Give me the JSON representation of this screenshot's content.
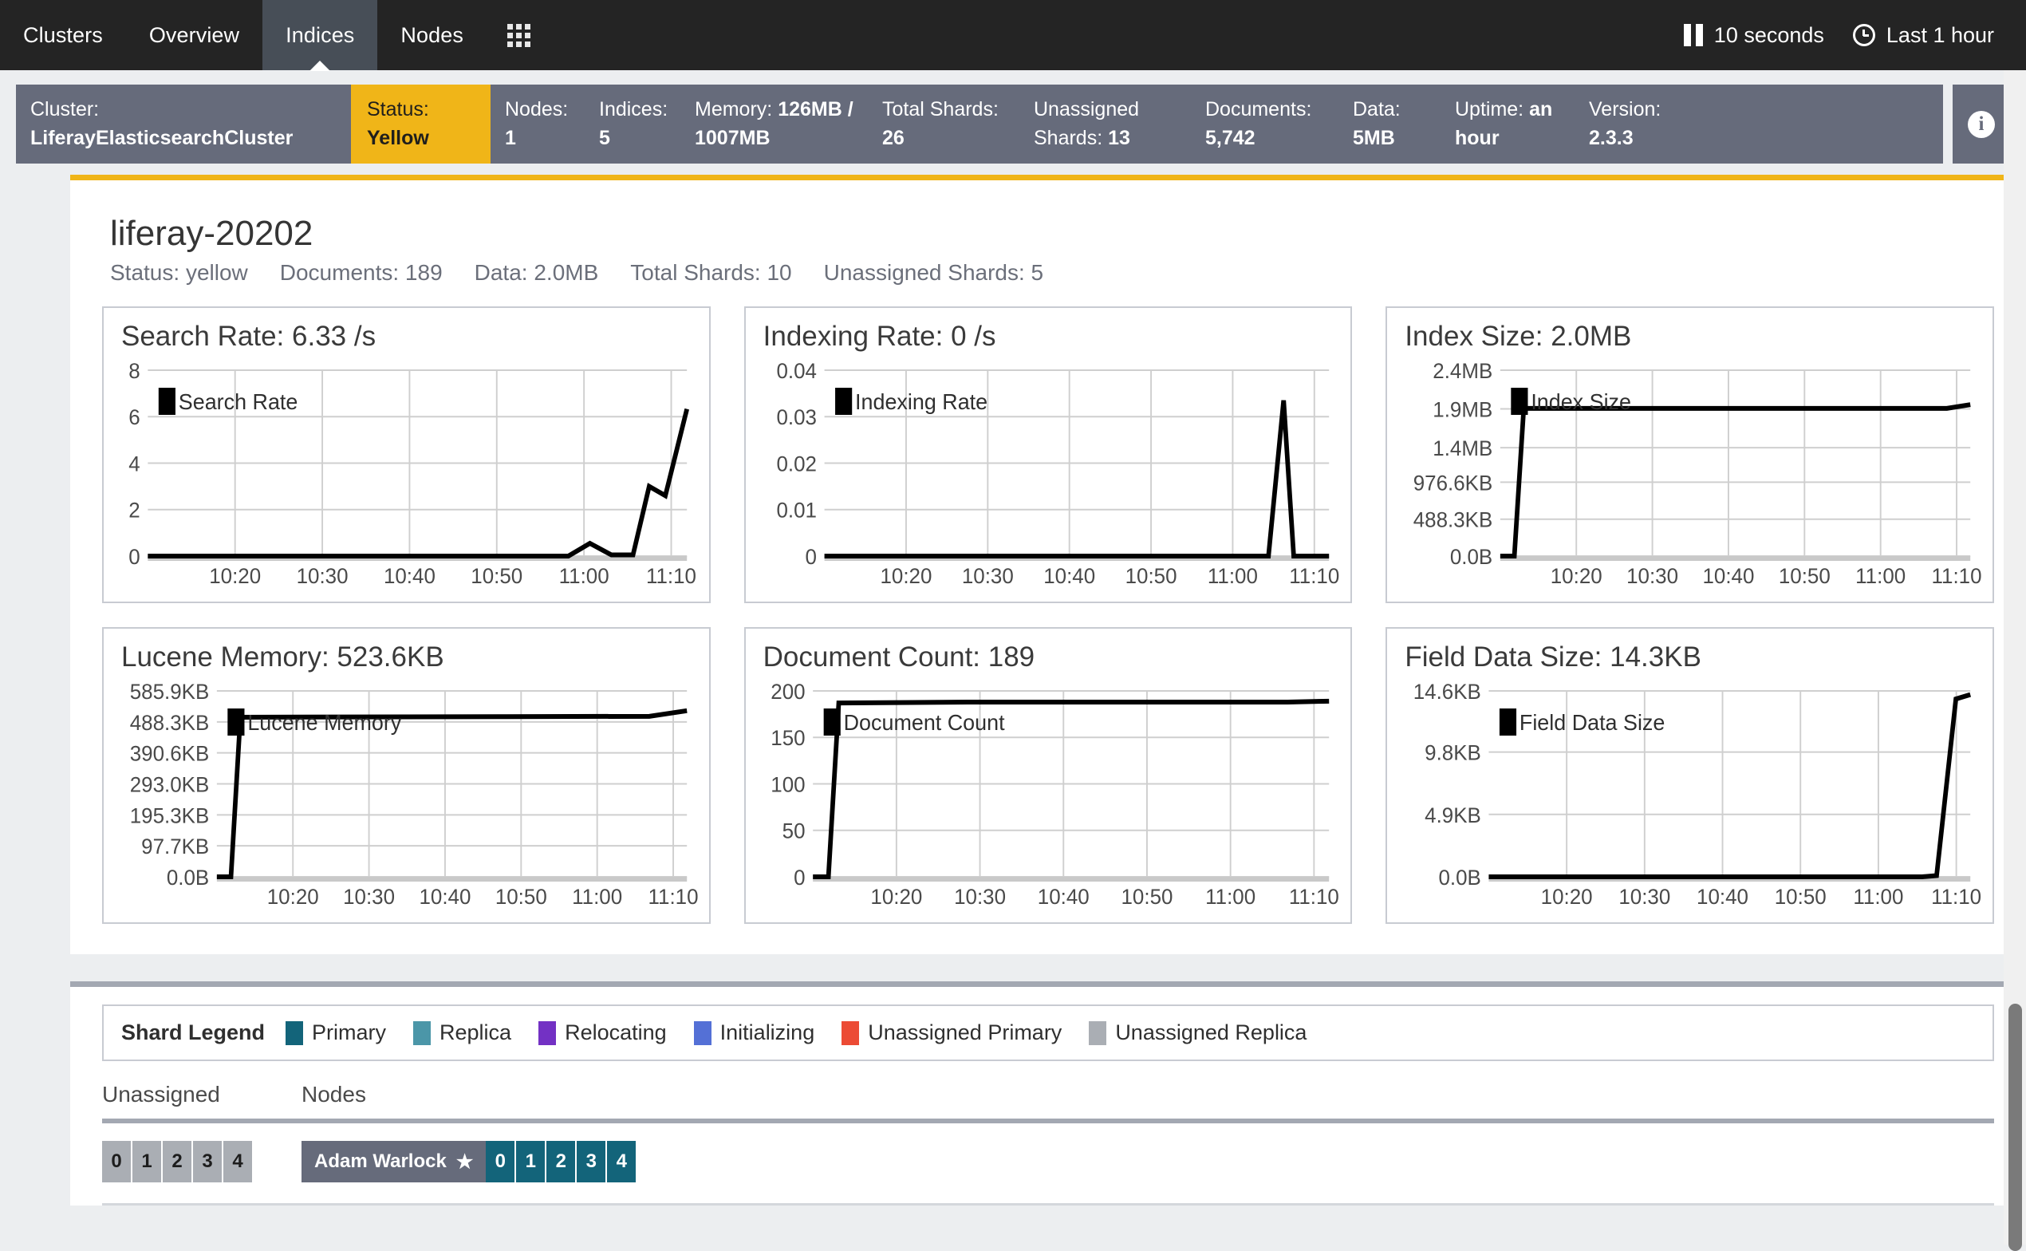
{
  "nav": {
    "items": [
      {
        "label": "Clusters",
        "active": false
      },
      {
        "label": "Overview",
        "active": false
      },
      {
        "label": "Indices",
        "active": true
      },
      {
        "label": "Nodes",
        "active": false
      }
    ],
    "grid_icon": "apps-grid-icon",
    "refresh_interval": "10 seconds",
    "pause_icon": "pause-icon",
    "clock_icon": "clock-icon",
    "time_range": "Last 1 hour"
  },
  "cluster": {
    "name_label": "Cluster:",
    "name_value": "LiferayElasticsearchCluster",
    "status_label": "Status:",
    "status_value": "Yellow",
    "status_color": "#f0b518",
    "info_icon": "info-icon",
    "stats": [
      {
        "label": "Nodes:",
        "value": "1",
        "w": "w-nodes"
      },
      {
        "label": "Indices:",
        "value": "5",
        "w": "w-indices"
      },
      {
        "label": "Memory:",
        "value": "126MB / 1007MB",
        "w": "w-mem"
      },
      {
        "label": "Total Shards:",
        "value": "26",
        "w": "w-total"
      },
      {
        "label": "Unassigned Shards:",
        "value": "13",
        "w": "w-unass"
      },
      {
        "label": "Documents:",
        "value": "5,742",
        "w": "w-docs"
      },
      {
        "label": "Data:",
        "value": "5MB",
        "w": "w-data"
      },
      {
        "label": "Uptime:",
        "value": "an hour",
        "w": "w-uptime"
      },
      {
        "label": "Version:",
        "value": "2.3.3",
        "w": "w-ver"
      }
    ]
  },
  "index": {
    "title": "liferay-20202",
    "stats": [
      "Status: yellow",
      "Documents: 189",
      "Data: 2.0MB",
      "Total Shards: 10",
      "Unassigned Shards: 5"
    ]
  },
  "chart_data": [
    {
      "type": "line",
      "title": "Search Rate: 6.33 /s",
      "legend": "Search Rate",
      "legend_position": "top-left",
      "xlabel": "",
      "ylabel": "",
      "grid": true,
      "ylim": [
        0,
        8
      ],
      "yticks": [
        "0",
        "2",
        "4",
        "6",
        "8"
      ],
      "ytick_values": [
        0,
        2,
        4,
        6,
        8
      ],
      "xticks": [
        "10:20",
        "10:30",
        "10:40",
        "10:50",
        "11:00",
        "11:10"
      ],
      "x": [
        0,
        5,
        12,
        20,
        30,
        40,
        50,
        60,
        68,
        74,
        78,
        82,
        86,
        90,
        93,
        96,
        100
      ],
      "values": [
        0,
        0,
        0,
        0,
        0,
        0,
        0,
        0,
        0,
        0,
        0,
        0.55,
        0.05,
        0.05,
        3.0,
        2.6,
        6.33
      ]
    },
    {
      "type": "line",
      "title": "Indexing Rate: 0 /s",
      "legend": "Indexing Rate",
      "legend_position": "top-left",
      "xlabel": "",
      "ylabel": "",
      "grid": true,
      "ylim": [
        0,
        0.04
      ],
      "yticks": [
        "0",
        "0.01",
        "0.02",
        "0.03",
        "0.04"
      ],
      "ytick_values": [
        0,
        0.01,
        0.02,
        0.03,
        0.04
      ],
      "xticks": [
        "10:20",
        "10:30",
        "10:40",
        "10:50",
        "11:00",
        "11:10"
      ],
      "x": [
        0,
        10,
        20,
        30,
        40,
        50,
        60,
        70,
        80,
        88,
        91,
        93,
        95,
        100
      ],
      "values": [
        0,
        0,
        0,
        0,
        0,
        0,
        0,
        0,
        0,
        0,
        0.0335,
        0.0,
        0,
        0
      ]
    },
    {
      "type": "line",
      "title": "Index Size: 2.0MB",
      "legend": "Index Size",
      "legend_position": "top-left",
      "xlabel": "",
      "ylabel": "",
      "grid": true,
      "ylim": [
        0,
        2516582
      ],
      "yticks": [
        "0.0B",
        "488.3KB",
        "976.6KB",
        "1.4MB",
        "1.9MB",
        "2.4MB"
      ],
      "ytick_values": [
        0,
        500019,
        1000038,
        1468006,
        1992294,
        2516582
      ],
      "xticks": [
        "10:20",
        "10:30",
        "10:40",
        "10:50",
        "11:00",
        "11:10"
      ],
      "x": [
        0,
        3,
        5,
        30,
        60,
        95,
        100
      ],
      "values": [
        0,
        0,
        2000000,
        2000000,
        2000000,
        2000000,
        2050000
      ]
    },
    {
      "type": "line",
      "title": "Lucene Memory: 523.6KB",
      "legend": "Lucene Memory",
      "legend_position": "top-left",
      "xlabel": "",
      "ylabel": "",
      "grid": true,
      "ylim": [
        0,
        599962
      ],
      "yticks": [
        "0.0B",
        "97.7KB",
        "195.3KB",
        "293.0KB",
        "390.6KB",
        "488.3KB",
        "585.9KB"
      ],
      "ytick_values": [
        0,
        100045,
        199987,
        300032,
        399974,
        500019,
        599962
      ],
      "xticks": [
        "10:20",
        "10:30",
        "10:40",
        "10:50",
        "11:00",
        "11:10"
      ],
      "x": [
        0,
        3,
        5,
        30,
        60,
        92,
        100
      ],
      "values": [
        0,
        0,
        515000,
        516000,
        517000,
        518000,
        536000
      ]
    },
    {
      "type": "line",
      "title": "Document Count: 189",
      "legend": "Document Count",
      "legend_position": "top-left",
      "xlabel": "",
      "ylabel": "",
      "grid": true,
      "ylim": [
        0,
        200
      ],
      "yticks": [
        "0",
        "50",
        "100",
        "150",
        "200"
      ],
      "ytick_values": [
        0,
        50,
        100,
        150,
        200
      ],
      "xticks": [
        "10:20",
        "10:30",
        "10:40",
        "10:50",
        "11:00",
        "11:10"
      ],
      "x": [
        0,
        3,
        5,
        30,
        60,
        92,
        100
      ],
      "values": [
        0,
        0,
        187,
        188,
        188,
        188,
        189
      ]
    },
    {
      "type": "line",
      "title": "Field Data Size: 14.3KB",
      "legend": "Field Data Size",
      "legend_position": "top-left",
      "xlabel": "",
      "ylabel": "",
      "grid": true,
      "ylim": [
        0,
        14950
      ],
      "yticks": [
        "0.0B",
        "4.9KB",
        "9.8KB",
        "14.6KB"
      ],
      "ytick_values": [
        0,
        5017,
        10035,
        14950
      ],
      "xticks": [
        "10:20",
        "10:30",
        "10:40",
        "10:50",
        "11:00",
        "11:10"
      ],
      "x": [
        0,
        20,
        50,
        80,
        90,
        93,
        97,
        100
      ],
      "values": [
        0,
        0,
        0,
        0,
        0,
        100,
        14300,
        14650
      ]
    }
  ],
  "shard_legend": {
    "title": "Shard Legend",
    "items": [
      {
        "label": "Primary",
        "color": "#13647a"
      },
      {
        "label": "Replica",
        "color": "#4b96a8"
      },
      {
        "label": "Relocating",
        "color": "#7331c4"
      },
      {
        "label": "Initializing",
        "color": "#5470d6"
      },
      {
        "label": "Unassigned Primary",
        "color": "#ec4b35"
      },
      {
        "label": "Unassigned Replica",
        "color": "#aaaeb4"
      }
    ]
  },
  "shard_table": {
    "unassigned_header": "Unassigned",
    "nodes_header": "Nodes",
    "unassigned_shards": [
      "0",
      "1",
      "2",
      "3",
      "4"
    ],
    "node": {
      "name": "Adam Warlock",
      "master_icon": "star-icon",
      "shards": [
        "0",
        "1",
        "2",
        "3",
        "4"
      ]
    }
  }
}
